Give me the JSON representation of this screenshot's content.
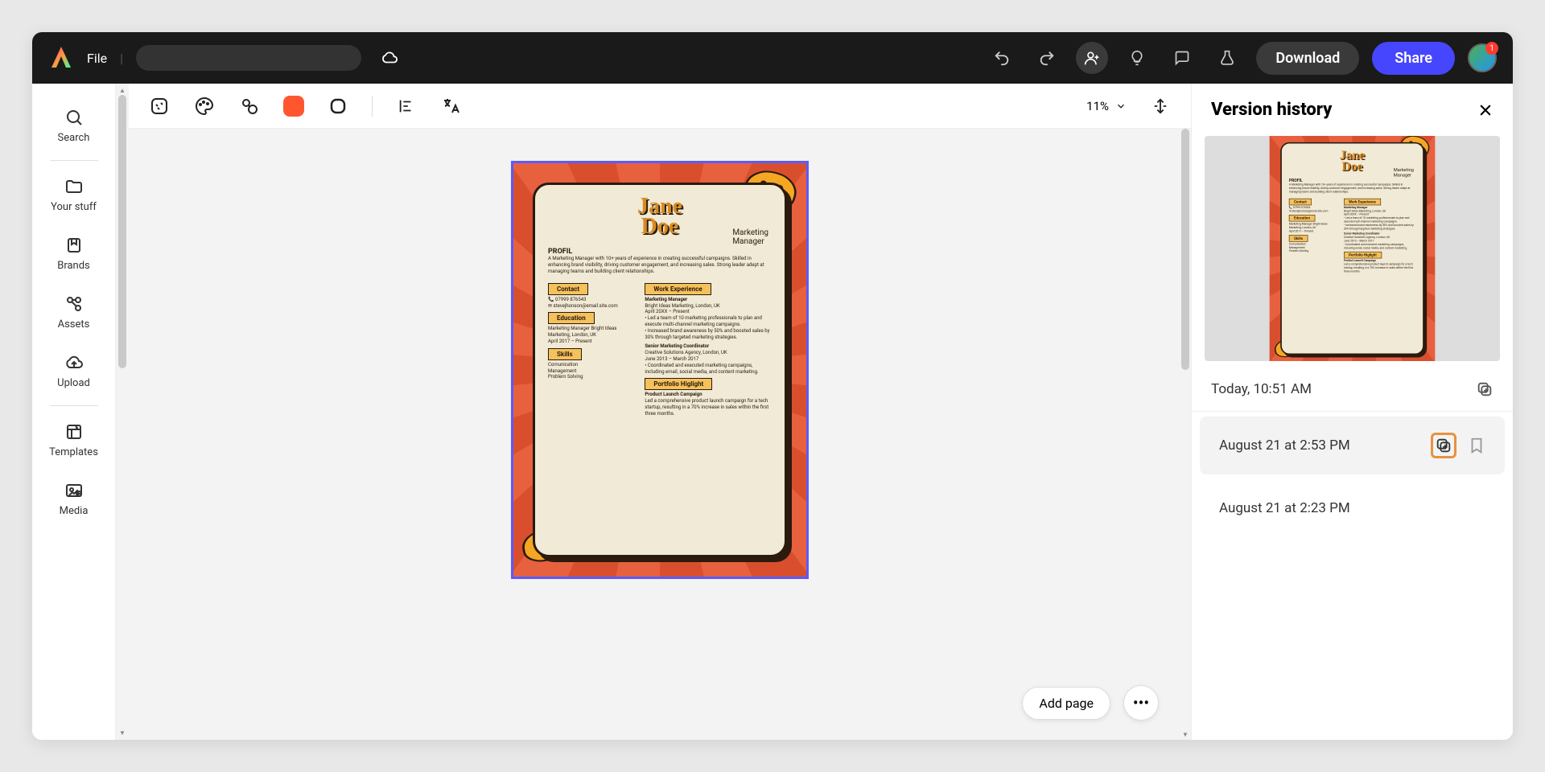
{
  "topbar": {
    "file_label": "File",
    "download_label": "Download",
    "share_label": "Share",
    "notification_count": "1"
  },
  "sidebar": {
    "items": [
      {
        "label": "Search",
        "icon": "search"
      },
      {
        "label": "Your stuff",
        "icon": "folder"
      },
      {
        "label": "Brands",
        "icon": "brand"
      },
      {
        "label": "Assets",
        "icon": "assets"
      },
      {
        "label": "Upload",
        "icon": "upload"
      },
      {
        "label": "Templates",
        "icon": "templates"
      },
      {
        "label": "Media",
        "icon": "media"
      }
    ]
  },
  "toolbar": {
    "zoom_level": "11%"
  },
  "canvas": {
    "add_page_label": "Add page",
    "resume": {
      "name_first": "Jane",
      "name_last": "Doe",
      "role_line1": "Marketing",
      "role_line2": "Manager",
      "profil_heading": "PROFIL",
      "profil_text": "A Marketing Manager with 10+ years of experience in creating successful campaigns. Skilled in enhancing brand visibility, driving customer engagement, and increasing sales. Strong leader adept at managing teams and building client relationships.",
      "contact_heading": "Contact",
      "contact_phone": "07999 876543",
      "contact_email": "stevejhonson@email.site.com",
      "education_heading": "Education",
      "education_text": "Marketing Manager Bright Ideas\nMarketing, London, UK\nApril 2017 – Present",
      "skills_heading": "Skills",
      "skills": [
        "Comunication",
        "Management",
        "Problem Solving"
      ],
      "work_heading": "Work Experience",
      "work_title1": "Marketing Manager",
      "work_company1": "Bright Ideas Marketing, London, UK\nApril 20XX – Present",
      "work_bullets1": "• Led a team of 10 marketing professionals to plan and execute multi-channel marketing campaigns.\n• Increased brand awareness by 50% and boosted sales by 30% through targeted marketing strategies.",
      "work_title2": "Senior Marketing Coordinator",
      "work_company2": "Creative Solutions Agency, London, UK\nJune 2013 – March 2017",
      "work_bullets2": "• Coordinated and executed marketing campaigns, including email, social media, and content marketing.",
      "portfolio_heading": "Portfolio Higlight",
      "portfolio_title": "Product Launch Campaign",
      "portfolio_text": "Led a comprehensive product launch campaign for a tech startup, resulting in a 70% increase in sales within the first three months."
    }
  },
  "version_panel": {
    "title": "Version history",
    "current_label": "Today, 10:51 AM",
    "versions": [
      {
        "label": "August 21 at 2:53 PM"
      },
      {
        "label": "August 21 at 2:23 PM"
      }
    ]
  }
}
